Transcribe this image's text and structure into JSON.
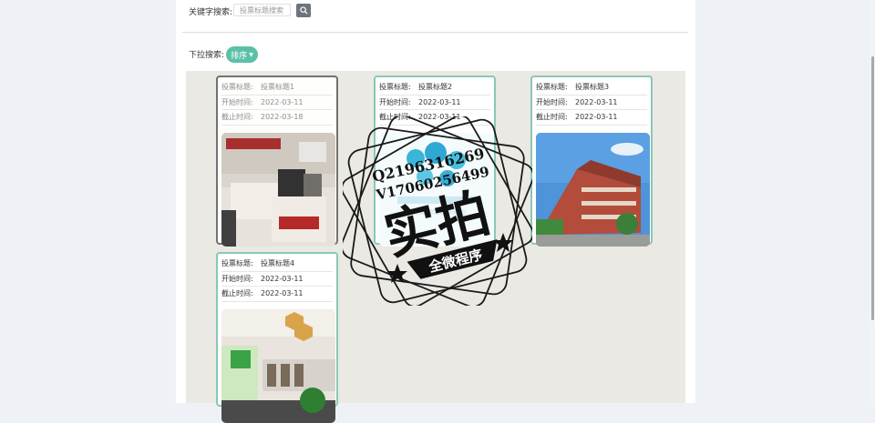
{
  "search": {
    "label": "关键字搜索:",
    "placeholder": "投票标题搜索"
  },
  "filter": {
    "label": "下拉搜索:",
    "sort_label": "排序"
  },
  "field_labels": {
    "title": "投票标题:",
    "start": "开始时间:",
    "end": "截止时间:"
  },
  "cards": [
    {
      "title": "投票标题1",
      "start": "2022-03-11",
      "end": "2022-03-18"
    },
    {
      "title": "投票标题2",
      "start": "2022-03-11",
      "end": "2022-03-11"
    },
    {
      "title": "投票标题3",
      "start": "2022-03-11",
      "end": "2022-03-11"
    },
    {
      "title": "投票标题4",
      "start": "2022-03-11",
      "end": "2022-03-11"
    }
  ],
  "watermark": {
    "line1": "Q2196316269",
    "line2": "V17060256499",
    "big": "实拍",
    "banner": "全微程序"
  },
  "colors": {
    "accent": "#5bc0a8",
    "card_border": "#87c9b6",
    "search_button": "#6c757d"
  }
}
